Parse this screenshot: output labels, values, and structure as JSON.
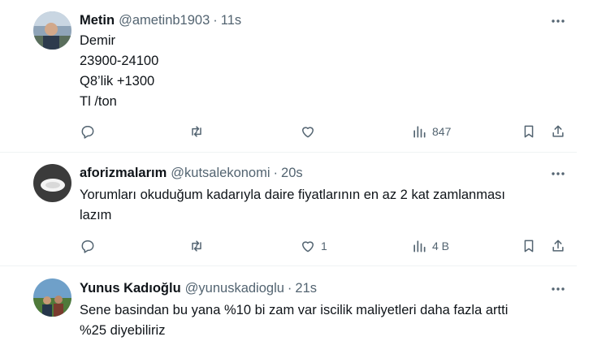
{
  "tweets": [
    {
      "name": "Metin",
      "handle": "@ametinb1903",
      "separator": "·",
      "time": "11s",
      "lines": [
        "Demir",
        "23900-24100",
        "Q8’lik +1300",
        "Tl /ton"
      ],
      "like_count": "",
      "views_count": "847"
    },
    {
      "name": "aforizmalarım",
      "handle": "@kutsalekonomi",
      "separator": "·",
      "time": "20s",
      "lines": [
        "Yorumları okuduğum kadarıyla daire fiyatlarının en az 2 kat zamlanması",
        "lazım"
      ],
      "like_count": "1",
      "views_count": "4 B"
    },
    {
      "name": "Yunus Kadıoğlu",
      "handle": "@yunuskadioglu",
      "separator": "·",
      "time": "21s",
      "lines": [
        "Sene basindan bu yana %10 bi zam var iscilik maliyetleri daha fazla artti",
        "%25 diyebiliriz"
      ]
    }
  ],
  "icons": {
    "reply": "reply-icon",
    "repost": "repost-icon",
    "like": "like-icon",
    "views": "views-icon",
    "bookmark": "bookmark-icon",
    "share": "share-icon",
    "more": "more-icon"
  },
  "colors": {
    "text": "#0f1419",
    "secondary": "#536471",
    "divider": "#eff3f4"
  }
}
